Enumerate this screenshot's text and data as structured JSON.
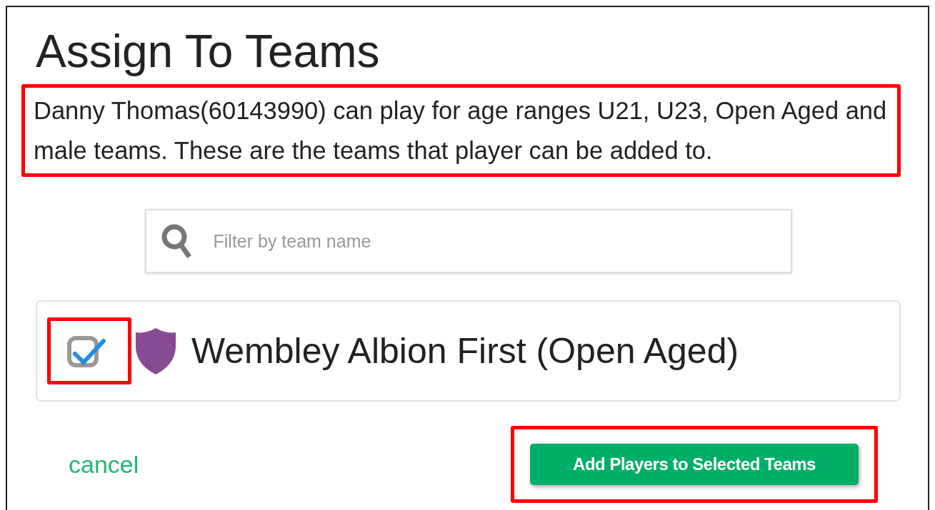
{
  "title": "Assign To Teams",
  "description": "Danny Thomas(60143990) can play for age ranges U21, U23, Open Aged and male teams. These are the teams that player can be added to.",
  "search": {
    "placeholder": "Filter by team name"
  },
  "teams": [
    {
      "name": "Wembley Albion First (Open Aged)",
      "checked": true
    }
  ],
  "cancel": "cancel",
  "submit": "Add Players to Selected Teams"
}
